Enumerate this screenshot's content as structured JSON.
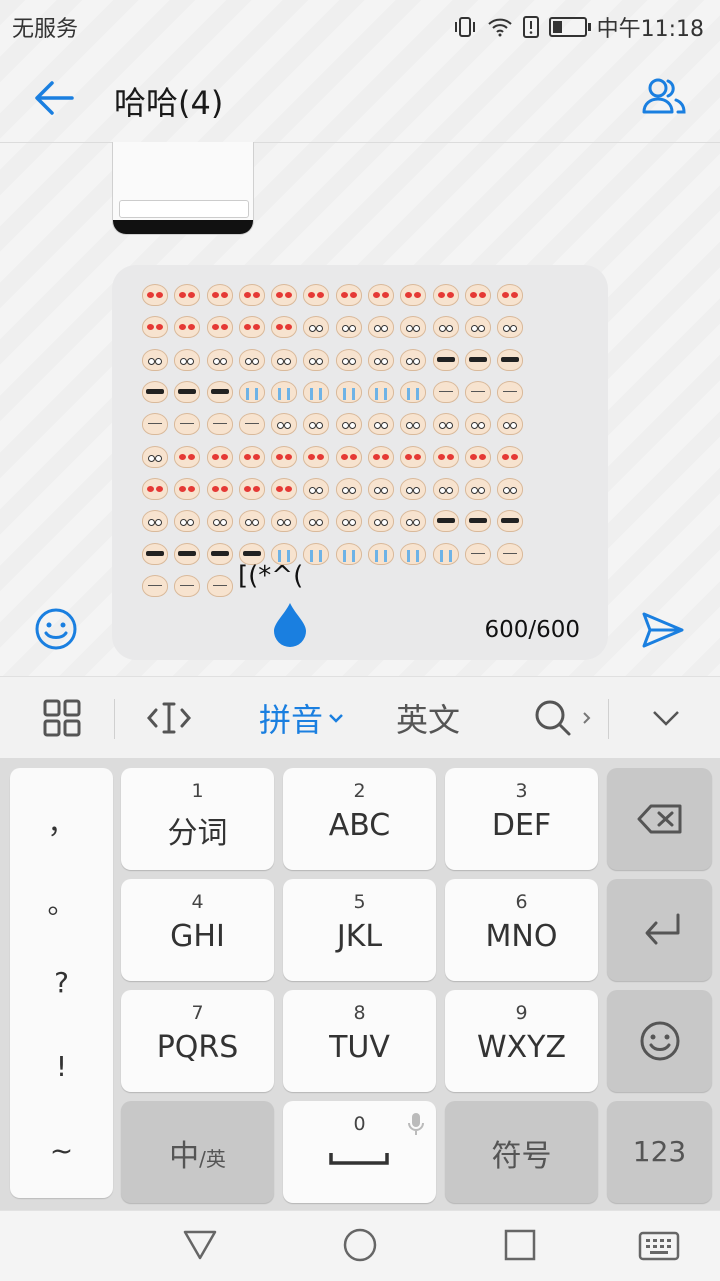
{
  "status_bar": {
    "carrier": "无服务",
    "time": "中午11:18"
  },
  "header": {
    "title": "哈哈(4)"
  },
  "message": {
    "tail_text": "[(*^(",
    "counter": "600/600",
    "emoji_rows": [
      [
        "heart",
        "heart",
        "heart",
        "heart",
        "heart",
        "heart",
        "heart",
        "heart",
        "heart",
        "heart",
        "heart",
        "heart"
      ],
      [
        "heart",
        "heart",
        "heart",
        "heart",
        "heart",
        "eyes",
        "eyes",
        "eyes",
        "eyes",
        "eyes",
        "eyes",
        "eyes"
      ],
      [
        "eyes",
        "eyes",
        "eyes",
        "eyes",
        "eyes",
        "eyes",
        "eyes",
        "eyes",
        "eyes",
        "cool",
        "cool",
        "cool"
      ],
      [
        "cool",
        "cool",
        "cool",
        "cry",
        "cry",
        "cry",
        "cry",
        "cry",
        "cry",
        "sleep",
        "sleep",
        "sleep"
      ],
      [
        "sleep",
        "sleep",
        "sleep",
        "sleep",
        "eyes",
        "eyes",
        "eyes",
        "eyes",
        "eyes",
        "eyes",
        "eyes",
        "eyes"
      ],
      [
        "eyes",
        "heart",
        "heart",
        "heart",
        "heart",
        "heart",
        "heart",
        "heart",
        "heart",
        "heart",
        "heart",
        "heart"
      ],
      [
        "heart",
        "heart",
        "heart",
        "heart",
        "heart",
        "eyes",
        "eyes",
        "eyes",
        "eyes",
        "eyes",
        "eyes",
        "eyes"
      ],
      [
        "eyes",
        "eyes",
        "eyes",
        "eyes",
        "eyes",
        "eyes",
        "eyes",
        "eyes",
        "eyes",
        "cool",
        "cool",
        "cool"
      ],
      [
        "cool",
        "cool",
        "cool",
        "cool",
        "cry",
        "cry",
        "cry",
        "cry",
        "cry",
        "cry",
        "sleep",
        "sleep"
      ],
      [
        "sleep",
        "sleep",
        "sleep"
      ]
    ]
  },
  "keyboard_toolbar": {
    "pinyin": "拼音",
    "english": "英文"
  },
  "keyboard": {
    "side_symbols": [
      "，",
      "。",
      "?",
      "!",
      "~"
    ],
    "keys": [
      {
        "num": "1",
        "label": "分词"
      },
      {
        "num": "2",
        "label": "ABC"
      },
      {
        "num": "3",
        "label": "DEF"
      },
      {
        "num": "4",
        "label": "GHI"
      },
      {
        "num": "5",
        "label": "JKL"
      },
      {
        "num": "6",
        "label": "MNO"
      },
      {
        "num": "7",
        "label": "PQRS"
      },
      {
        "num": "8",
        "label": "TUV"
      },
      {
        "num": "9",
        "label": "WXYZ"
      }
    ],
    "zh_en_main": "中",
    "zh_en_sub": "/英",
    "space_num": "0",
    "symbols_label": "符号",
    "numbers_label": "123"
  },
  "colors": {
    "accent": "#1a7fe0",
    "key_dark": "#c8c8c8"
  }
}
